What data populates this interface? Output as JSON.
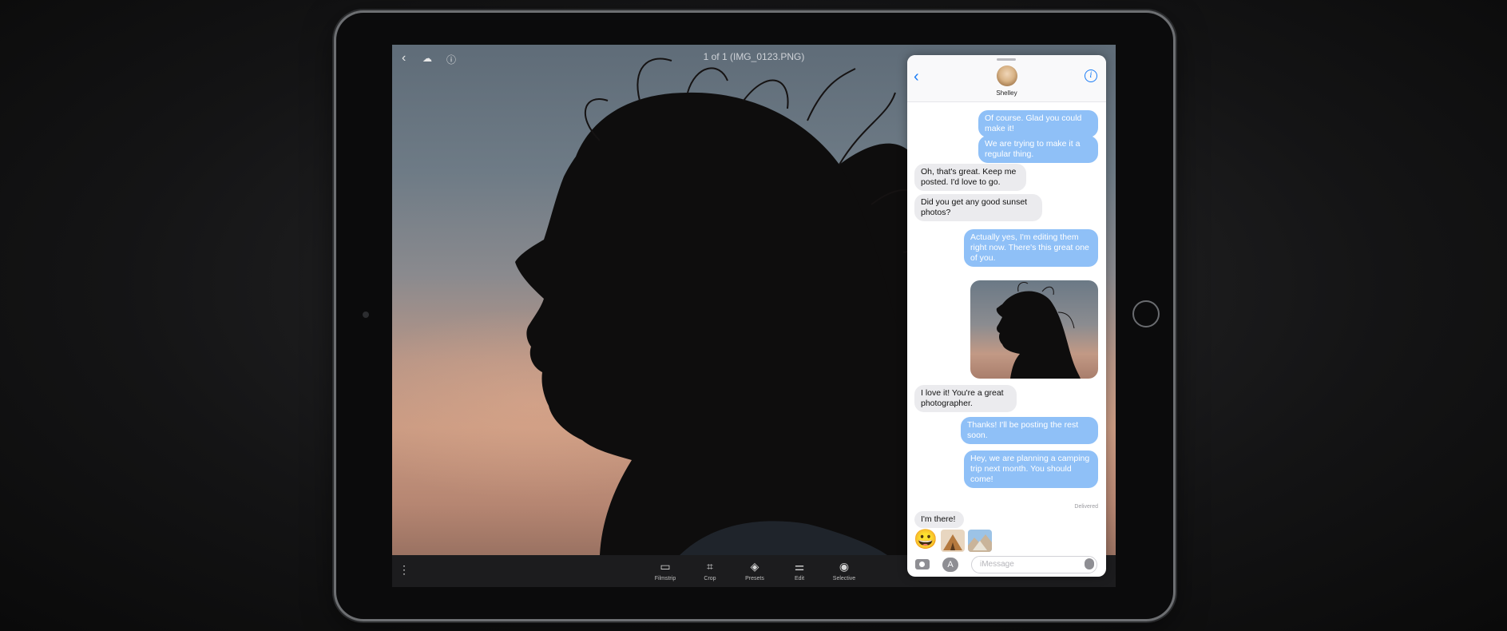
{
  "photo_app": {
    "title": "1 of 1 (IMG_0123.PNG)",
    "top_icons": [
      "back-chevron-icon",
      "cloud-upload-icon",
      "info-icon"
    ],
    "tools": [
      {
        "label": "Filmstrip",
        "icon": "filmstrip-icon",
        "glyph": "▭"
      },
      {
        "label": "Crop",
        "icon": "crop-icon",
        "glyph": "⌗"
      },
      {
        "label": "Presets",
        "icon": "presets-icon",
        "glyph": "◈"
      },
      {
        "label": "Edit",
        "icon": "edit-sliders-icon",
        "glyph": "⚌"
      },
      {
        "label": "Selective",
        "icon": "selective-icon",
        "glyph": "◉"
      }
    ]
  },
  "messages": {
    "contact_name": "Shelley",
    "bubbles": [
      {
        "from": "me",
        "text": "Of course. Glad you could make it!"
      },
      {
        "from": "me",
        "text": "We are trying to make it a regular thing."
      },
      {
        "from": "them",
        "text": "Oh, that's great. Keep me posted. I'd love to go."
      },
      {
        "from": "them",
        "text": "Did you get any good sunset photos?"
      },
      {
        "from": "me",
        "text": "Actually yes, I'm editing them right now. There's this great one of you."
      },
      {
        "from": "them",
        "text": "I love it! You're a great photographer."
      },
      {
        "from": "me",
        "text": "Thanks! I'll be posting the rest soon."
      },
      {
        "from": "me",
        "text": "Hey, we are planning a camping trip next month. You should come!"
      },
      {
        "from": "them",
        "text": "I'm there!"
      }
    ],
    "delivered_label": "Delivered",
    "emoji": "😀",
    "input_placeholder": "iMessage"
  },
  "colors": {
    "outgoing_bubble": "#8fc0f7",
    "incoming_bubble": "#ebebee",
    "accent": "#1a7cf5"
  }
}
